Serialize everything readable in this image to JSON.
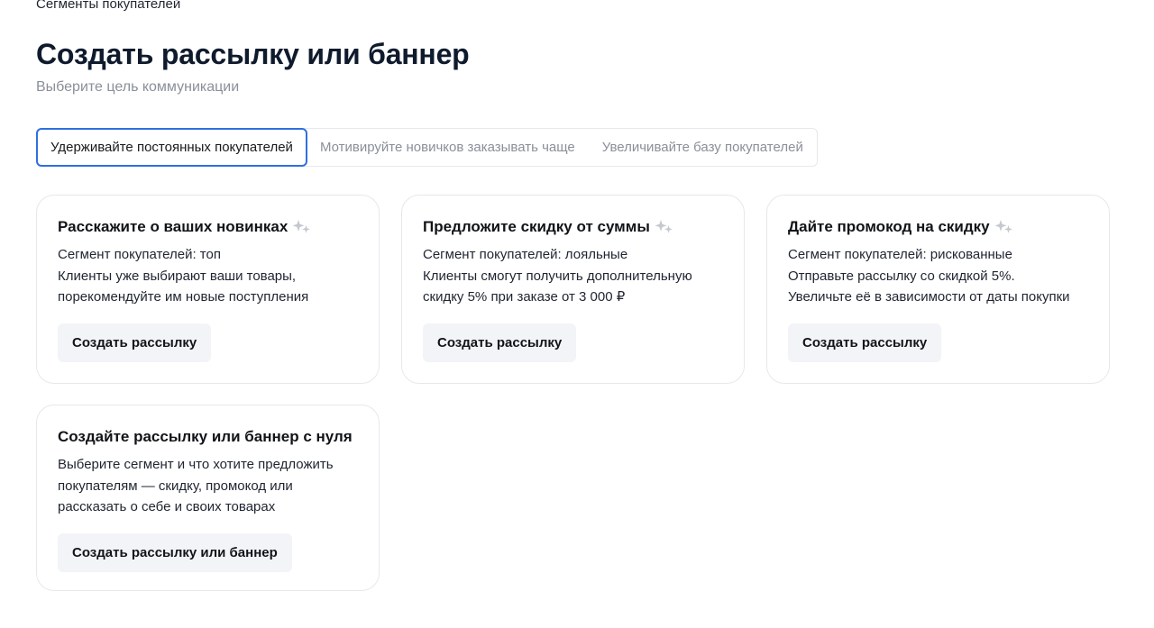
{
  "breadcrumb": "Сегменты покупателей",
  "header": {
    "title": "Создать рассылку или баннер",
    "subtitle": "Выберите цель коммуникации"
  },
  "tabs": [
    {
      "label": "Удерживайте постоянных покупателей",
      "active": true
    },
    {
      "label": "Мотивируйте новичков заказывать чаще",
      "active": false
    },
    {
      "label": "Увеличивайте базу покупателей",
      "active": false
    }
  ],
  "cards": [
    {
      "title": "Расскажите о ваших новинках",
      "icon": "sparkle-icon",
      "lines": [
        "Сегмент покупателей: топ",
        "Клиенты уже выбирают ваши товары,",
        "порекомендуйте им новые поступления"
      ],
      "button": "Создать рассылку"
    },
    {
      "title": "Предложите скидку от суммы",
      "icon": "sparkle-icon",
      "lines": [
        "Сегмент покупателей: лояльные",
        "Клиенты смогут получить дополнительную",
        "скидку 5% при заказе от 3 000 ₽"
      ],
      "button": "Создать рассылку"
    },
    {
      "title": "Дайте промокод на скидку",
      "icon": "sparkle-icon",
      "lines": [
        "Сегмент покупателей: рискованные",
        "Отправьте рассылку со скидкой 5%.",
        "Увеличьте её в зависимости от даты покупки"
      ],
      "button": "Создать рассылку"
    },
    {
      "title": "Создайте рассылку или баннер с нуля",
      "lines": [
        "Выберите сегмент и что хотите предложить",
        "покупателям — скидку, промокод или",
        "рассказать о себе и своих товарах"
      ],
      "button": "Создать рассылку или баннер"
    }
  ],
  "colors": {
    "accent": "#2f6fe0",
    "button_bg": "#f3f4f7",
    "muted_text": "#8a8f99"
  }
}
